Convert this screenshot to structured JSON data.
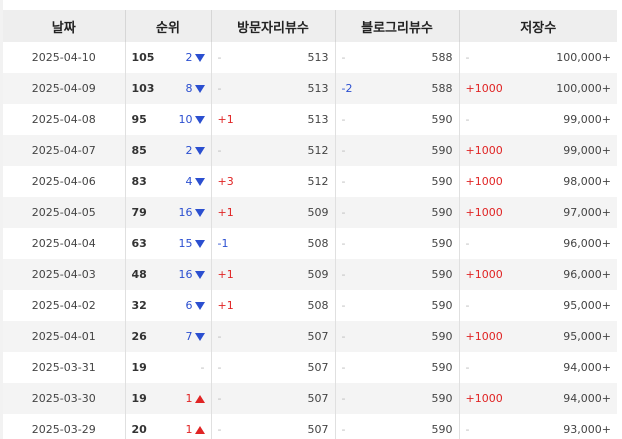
{
  "headers": [
    "날짜",
    "순위",
    "방문자리뷰수",
    "블로그리뷰수",
    "저장수"
  ],
  "colors": {
    "up": "#e02424",
    "down": "#2b4fd0",
    "header_bg": "#eeeeee",
    "row_alt": "#f4f4f4"
  },
  "rows": [
    {
      "date": "2025-04-10",
      "rank": "105",
      "rank_delta": "2",
      "dir": "down",
      "visit_chg": "-",
      "visit": "513",
      "blog_chg": "-",
      "blog": "588",
      "save_chg": "-",
      "save": "100,000+"
    },
    {
      "date": "2025-04-09",
      "rank": "103",
      "rank_delta": "8",
      "dir": "down",
      "visit_chg": "-",
      "visit": "513",
      "blog_chg": "-2",
      "blog": "588",
      "save_chg": "+1000",
      "save": "100,000+"
    },
    {
      "date": "2025-04-08",
      "rank": "95",
      "rank_delta": "10",
      "dir": "down",
      "visit_chg": "+1",
      "visit": "513",
      "blog_chg": "-",
      "blog": "590",
      "save_chg": "-",
      "save": "99,000+"
    },
    {
      "date": "2025-04-07",
      "rank": "85",
      "rank_delta": "2",
      "dir": "down",
      "visit_chg": "-",
      "visit": "512",
      "blog_chg": "-",
      "blog": "590",
      "save_chg": "+1000",
      "save": "99,000+"
    },
    {
      "date": "2025-04-06",
      "rank": "83",
      "rank_delta": "4",
      "dir": "down",
      "visit_chg": "+3",
      "visit": "512",
      "blog_chg": "-",
      "blog": "590",
      "save_chg": "+1000",
      "save": "98,000+"
    },
    {
      "date": "2025-04-05",
      "rank": "79",
      "rank_delta": "16",
      "dir": "down",
      "visit_chg": "+1",
      "visit": "509",
      "blog_chg": "-",
      "blog": "590",
      "save_chg": "+1000",
      "save": "97,000+"
    },
    {
      "date": "2025-04-04",
      "rank": "63",
      "rank_delta": "15",
      "dir": "down",
      "visit_chg": "-1",
      "visit": "508",
      "blog_chg": "-",
      "blog": "590",
      "save_chg": "-",
      "save": "96,000+"
    },
    {
      "date": "2025-04-03",
      "rank": "48",
      "rank_delta": "16",
      "dir": "down",
      "visit_chg": "+1",
      "visit": "509",
      "blog_chg": "-",
      "blog": "590",
      "save_chg": "+1000",
      "save": "96,000+"
    },
    {
      "date": "2025-04-02",
      "rank": "32",
      "rank_delta": "6",
      "dir": "down",
      "visit_chg": "+1",
      "visit": "508",
      "blog_chg": "-",
      "blog": "590",
      "save_chg": "-",
      "save": "95,000+"
    },
    {
      "date": "2025-04-01",
      "rank": "26",
      "rank_delta": "7",
      "dir": "down",
      "visit_chg": "-",
      "visit": "507",
      "blog_chg": "-",
      "blog": "590",
      "save_chg": "+1000",
      "save": "95,000+"
    },
    {
      "date": "2025-03-31",
      "rank": "19",
      "rank_delta": "-",
      "dir": "none",
      "visit_chg": "-",
      "visit": "507",
      "blog_chg": "-",
      "blog": "590",
      "save_chg": "-",
      "save": "94,000+"
    },
    {
      "date": "2025-03-30",
      "rank": "19",
      "rank_delta": "1",
      "dir": "up",
      "visit_chg": "-",
      "visit": "507",
      "blog_chg": "-",
      "blog": "590",
      "save_chg": "+1000",
      "save": "94,000+"
    },
    {
      "date": "2025-03-29",
      "rank": "20",
      "rank_delta": "1",
      "dir": "up",
      "visit_chg": "-",
      "visit": "507",
      "blog_chg": "-",
      "blog": "590",
      "save_chg": "-",
      "save": "93,000+"
    }
  ]
}
